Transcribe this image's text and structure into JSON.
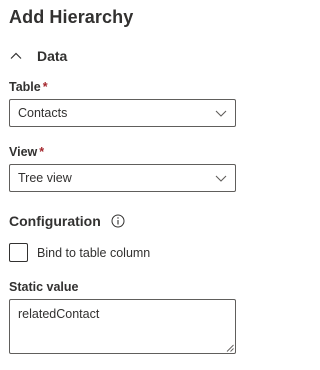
{
  "panel": {
    "title": "Add Hierarchy"
  },
  "section": {
    "label": "Data",
    "toggle_icon": "chevron-up-icon"
  },
  "table_field": {
    "label": "Table",
    "required_mark": "*",
    "value": "Contacts",
    "icon": "chevron-down-icon"
  },
  "view_field": {
    "label": "View",
    "required_mark": "*",
    "value": "Tree view",
    "icon": "chevron-down-icon"
  },
  "configuration": {
    "title": "Configuration",
    "icon": "info-icon"
  },
  "bind_checkbox": {
    "label": "Bind to table column",
    "checked": false
  },
  "static_value": {
    "label": "Static value",
    "value": "relatedContact"
  }
}
